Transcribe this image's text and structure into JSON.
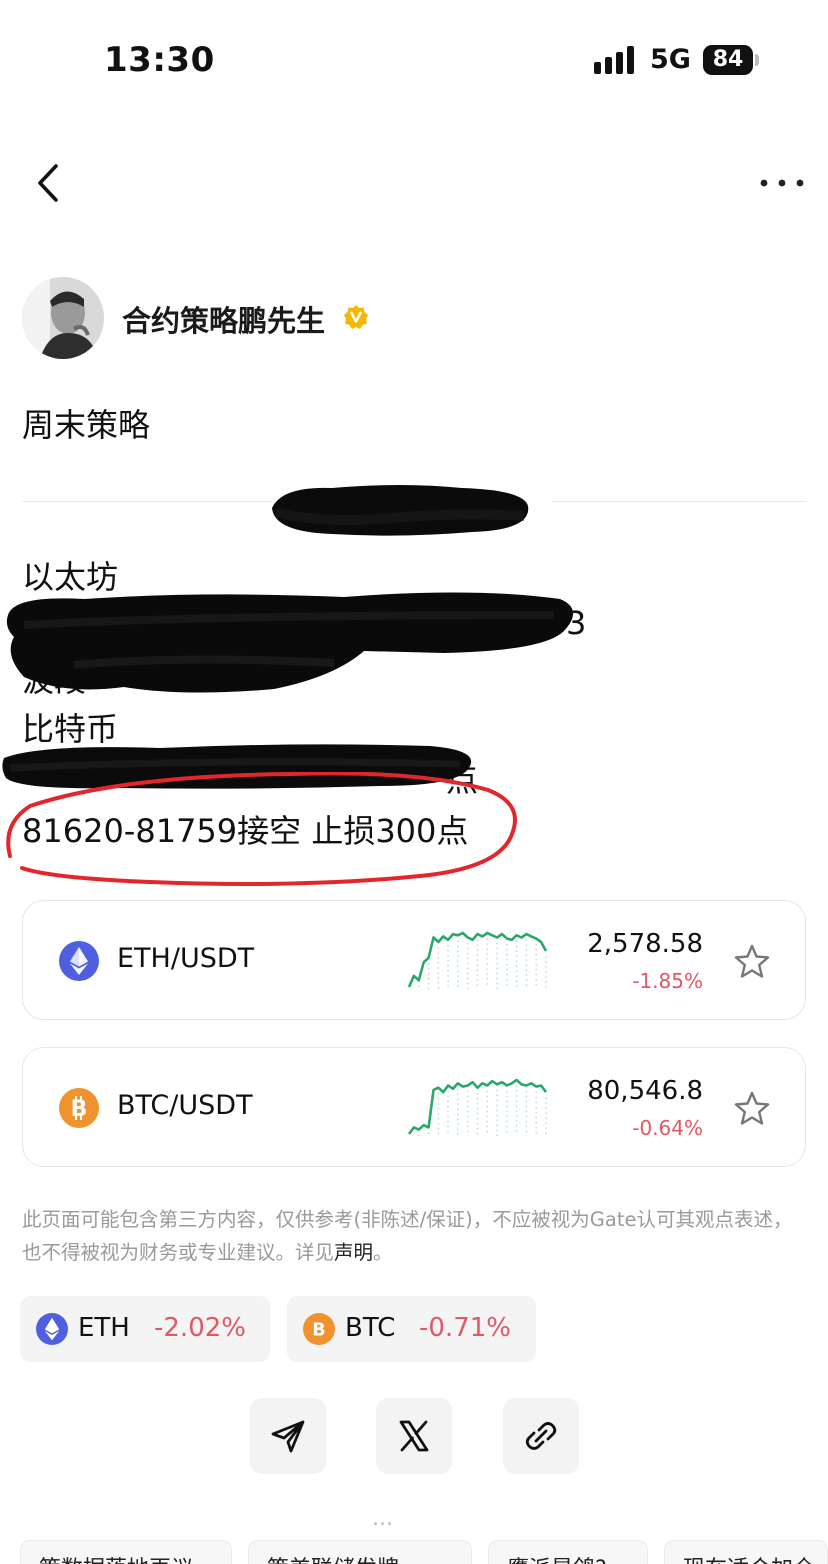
{
  "status_bar": {
    "time": "13:30",
    "network": "5G",
    "battery": "84"
  },
  "nav": {
    "back_icon": "chevron-left-icon",
    "more_icon": "more-horizontal-icon"
  },
  "author": {
    "name": "合约策略鹏先生",
    "verified_icon": "verified-badge-icon"
  },
  "post": {
    "title": "周末策略",
    "lines": {
      "eth_header": "以太坊",
      "redacted_1_tail": "3",
      "redacted_2_head": "波段",
      "btc_header": "比特币",
      "redacted_3_tail": "点",
      "btc_strategy": "81620-81759接空 止损300点"
    }
  },
  "pairs": [
    {
      "name": "ETH/USDT",
      "price": "2,578.58",
      "change": "-1.85%",
      "icon": "ethereum-icon",
      "spark": [
        8,
        18,
        14,
        30,
        34,
        52,
        48,
        53,
        50,
        55,
        54,
        56,
        52,
        50,
        55,
        53,
        56,
        54,
        52,
        55,
        51,
        50,
        54,
        52,
        55,
        53,
        51,
        48,
        40
      ]
    },
    {
      "name": "BTC/USDT",
      "price": "80,546.8",
      "change": "-0.64%",
      "icon": "bitcoin-icon",
      "spark": [
        6,
        12,
        10,
        14,
        12,
        46,
        48,
        44,
        50,
        47,
        52,
        49,
        50,
        53,
        48,
        52,
        50,
        54,
        51,
        53,
        50,
        52,
        55,
        51,
        50,
        52,
        49,
        50,
        44
      ]
    }
  ],
  "disclaimer": {
    "text": "此页面可能包含第三方内容，仅供参考(非陈述/保证)，不应被视为Gate认可其观点表述，也不得被视为财务或专业建议。详见",
    "link": "声明",
    "end": "。"
  },
  "tags": [
    {
      "symbol": "ETH",
      "change": "-2.02%"
    },
    {
      "symbol": "BTC",
      "change": "-0.71%"
    }
  ],
  "share": {
    "telegram_icon": "telegram-icon",
    "x_icon": "x-icon",
    "link_icon": "link-icon"
  },
  "more_label": "...",
  "chips": [
    "策数据落地再议",
    "策美联储发牌",
    "鹰派是鸽?",
    "现在适合加仓"
  ],
  "colors": {
    "up": "#2aa86b",
    "down": "#e05865",
    "eth": "#4f5fe0",
    "btc": "#f0932f",
    "badge": "#f5b700",
    "annotation": "#e3262c"
  }
}
